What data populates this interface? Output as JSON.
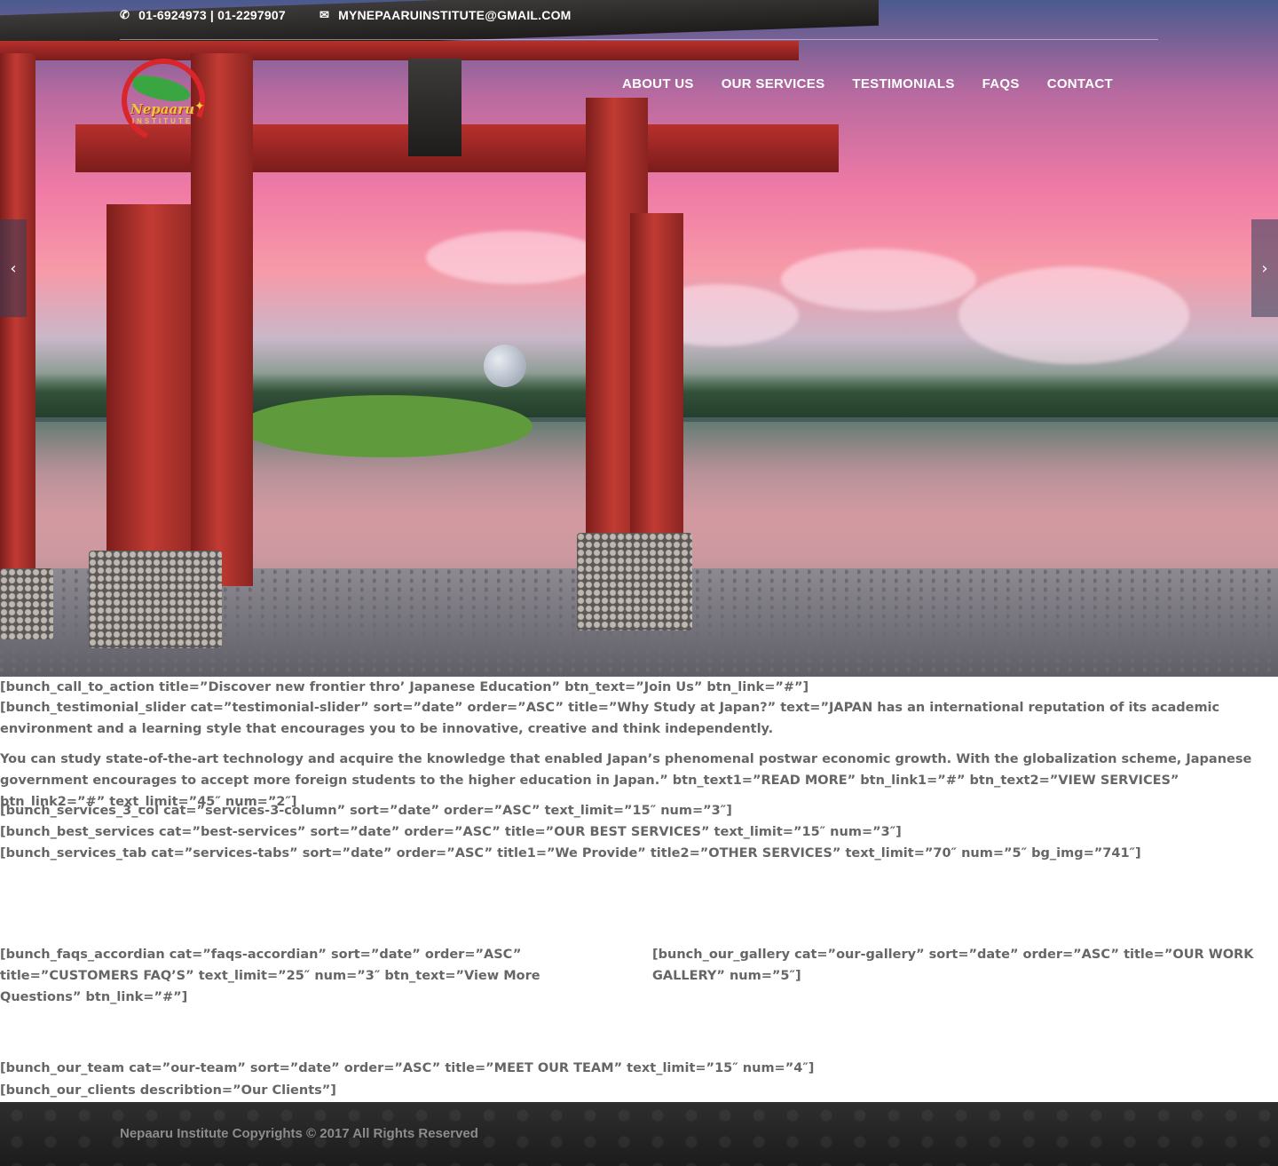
{
  "topbar": {
    "phone": "01-6924973 | 01-2297907",
    "email": "MYNEPAARUINSTITUTE@GMAIL.COM",
    "phone_icon": "phone-icon",
    "email_icon": "mail-icon"
  },
  "logo": {
    "name": "Nepaaru",
    "sub": "INSTITUTE"
  },
  "nav": {
    "items": [
      {
        "label": "ABOUT US"
      },
      {
        "label": "OUR SERVICES"
      },
      {
        "label": "TESTIMONIALS"
      },
      {
        "label": "FAQS"
      },
      {
        "label": "CONTACT"
      }
    ]
  },
  "slider": {
    "prev_icon": "chevron-left-icon",
    "next_icon": "chevron-right-icon",
    "prev_glyph": "‹",
    "next_glyph": "›"
  },
  "shortcodes": {
    "call_to_action": "[bunch_call_to_action title=”Discover new frontier thro’ Japanese Education” btn_text=”Join Us” btn_link=”#”]",
    "testimonial_line1": "[bunch_testimonial_slider cat=”testimonial-slider” sort=”date” order=”ASC” title=”Why Study at Japan?” text=”JAPAN has an international reputation of its academic environment and a learning style that encourages you to be innovative, creative and think independently.",
    "testimonial_line2": "You can study state-of-the-art technology and acquire the knowledge that enabled Japan’s phenomenal postwar economic growth. With the globalization scheme, Japanese government encourages to accept more foreign students to the higher education in Japan.” btn_text1=”READ MORE” btn_link1=”#” btn_text2=”VIEW SERVICES” btn_link2=”#” text_limit=”45″ num=”2″]",
    "services_3_col": "[bunch_services_3_col cat=”services-3-column” sort=”date” order=”ASC” text_limit=”15″ num=”3″]",
    "best_services": "[bunch_best_services cat=”best-services” sort=”date” order=”ASC” title=”OUR BEST SERVICES” text_limit=”15″ num=”3″]",
    "services_tab": "[bunch_services_tab cat=”services-tabs” sort=”date” order=”ASC” title1=”We Provide” title2=”OTHER SERVICES” text_limit=”70″ num=”5″ bg_img=”741″]",
    "faqs_accordian": "[bunch_faqs_accordian cat=”faqs-accordian” sort=”date” order=”ASC” title=”CUSTOMERS FAQ’S” text_limit=”25″ num=”3″ btn_text=”View More Questions” btn_link=”#”]",
    "our_gallery": "[bunch_our_gallery cat=”our-gallery” sort=”date” order=”ASC” title=”OUR WORK GALLERY” num=”5″]",
    "our_team": "[bunch_our_team cat=”our-team” sort=”date” order=”ASC” title=”MEET OUR TEAM” text_limit=”15″ num=”4″]",
    "our_clients": "[bunch_our_clients describtion=”Our Clients”]"
  },
  "footer": {
    "copyright": "Nepaaru Institute Copyrights © 2017 All Rights Reserved"
  },
  "colors": {
    "body_text": "#666666",
    "footer_bg": "#222222",
    "nav_text": "#ffffff"
  }
}
